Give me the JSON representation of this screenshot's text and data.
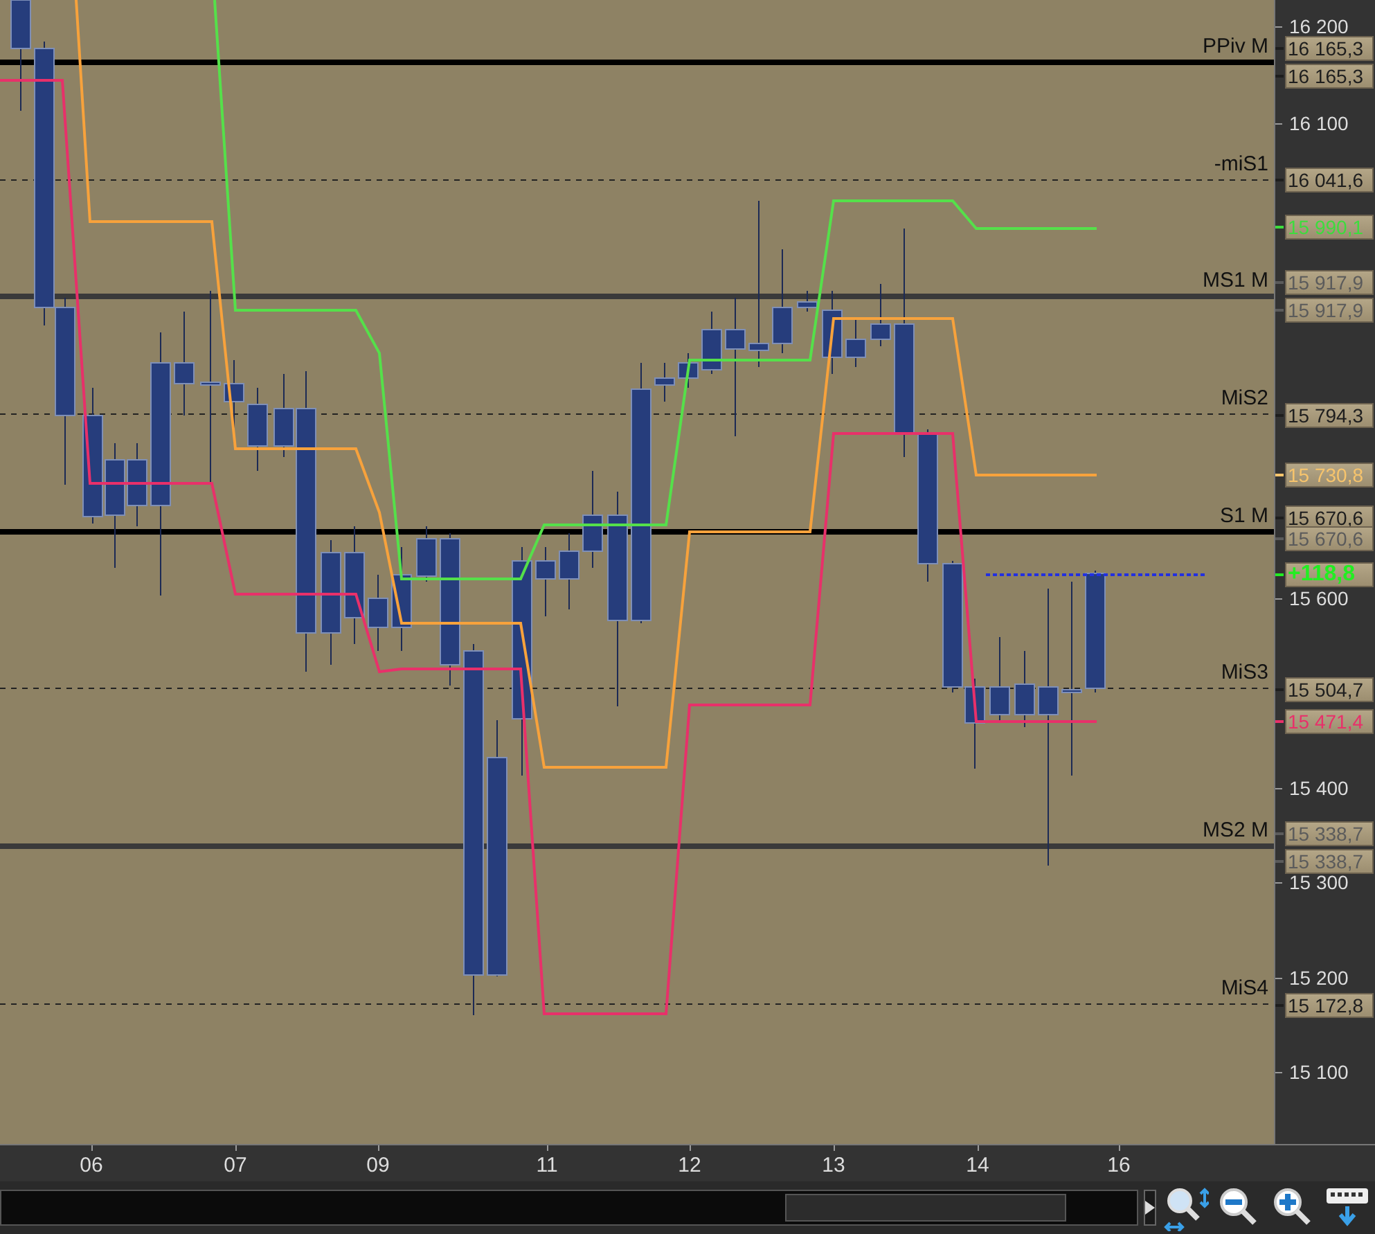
{
  "chart": {
    "levels": [
      {
        "label": "PPiv M",
        "kind": "major"
      },
      {
        "label": "-miS1",
        "kind": "mini"
      },
      {
        "label": "MS1 M",
        "kind": "monthly"
      },
      {
        "label": "MiS2",
        "kind": "mini"
      },
      {
        "label": "S1 M",
        "kind": "major"
      },
      {
        "label": "MiS3",
        "kind": "mini"
      },
      {
        "label": "MS2 M",
        "kind": "monthly"
      },
      {
        "label": "MiS4",
        "kind": "mini"
      }
    ],
    "y_ticks": [
      "16 200",
      "16 100",
      "15 600",
      "15 400",
      "15 300",
      "15 200",
      "15 100"
    ],
    "price_tags": [
      {
        "text": "16 165,3",
        "kind": "price",
        "color": "#1e1e1e"
      },
      {
        "text": "16 165,3",
        "kind": "price",
        "color": "#1e1e1e"
      },
      {
        "text": "16 041,6",
        "kind": "price",
        "color": "#1e1e1e"
      },
      {
        "text": "15 990,1",
        "kind": "price",
        "color": "#3ddc3d"
      },
      {
        "text": "15 917,9",
        "kind": "price",
        "color": "#5b5b5b"
      },
      {
        "text": "15 917,9",
        "kind": "price",
        "color": "#5b5b5b"
      },
      {
        "text": "15 794,3",
        "kind": "price",
        "color": "#1e1e1e"
      },
      {
        "text": "15 730,8",
        "kind": "price",
        "color": "#f7c46c"
      },
      {
        "text": "15 670,6",
        "kind": "price",
        "color": "#1e1e1e"
      },
      {
        "text": "15 670,6",
        "kind": "price",
        "color": "#5b5b5b"
      },
      {
        "text": "+118,8",
        "kind": "change",
        "color": "#22ee22"
      },
      {
        "text": "15 504,7",
        "kind": "price",
        "color": "#1e1e1e"
      },
      {
        "text": "15 471,4",
        "kind": "price",
        "color": "#e8306a"
      },
      {
        "text": "15 338,7",
        "kind": "price",
        "color": "#5b5b5b"
      },
      {
        "text": "15 338,7",
        "kind": "price",
        "color": "#5b5b5b"
      },
      {
        "text": "15 172,8",
        "kind": "price",
        "color": "#1e1e1e"
      }
    ],
    "x_ticks": [
      "06",
      "07",
      "09",
      "11",
      "12",
      "13",
      "14",
      "16"
    ]
  },
  "toolbar": {
    "buttons": [
      {
        "kind": "zoom-fit"
      },
      {
        "kind": "zoom-out"
      },
      {
        "kind": "zoom-in"
      },
      {
        "kind": "keyboard"
      }
    ]
  }
}
